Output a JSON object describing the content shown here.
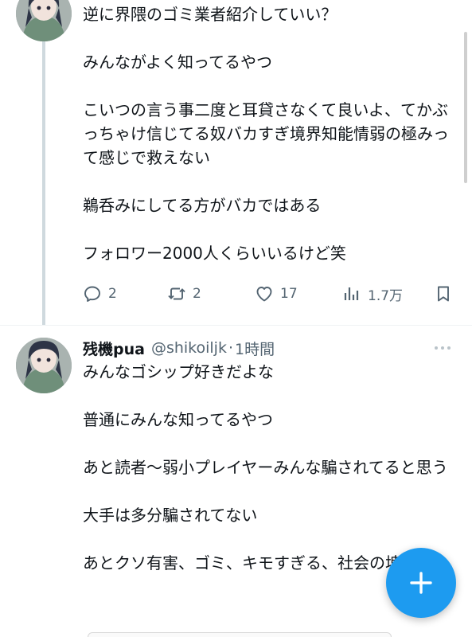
{
  "tweet1": {
    "paragraphs": [
      "逆に界隈のゴミ業者紹介していい？",
      "みんながよく知ってるやつ",
      "こいつの言う事二度と耳貸さなくて良いよ、てかぶっちゃけ信じてる奴バカすぎ境界知能情弱の極みって感じで救えない",
      "鵜呑みにしてる方がバカではある",
      "フォロワー2000人くらいいるけど笑"
    ],
    "actions": {
      "reply_count": "2",
      "retweet_count": "2",
      "like_count": "17",
      "view_count": "1.7万"
    }
  },
  "tweet2": {
    "name": "残機pua",
    "handle": "@shikoiljk",
    "separator": "·",
    "time": "1時間",
    "paragraphs": [
      "みんなゴシップ好きだよな",
      "普通にみんな知ってるやつ",
      "あと読者〜弱小プレイヤーみんな騙されてると思う",
      "大手は多分騙されてない",
      "あとクソ有害、ゴミ、キモすぎる、社会の塊"
    ]
  },
  "icons": {
    "reply": "reply-icon",
    "retweet": "retweet-icon",
    "like": "heart-icon",
    "views": "views-icon",
    "bookmark": "bookmark-icon",
    "more": "more-icon",
    "compose": "plus-icon"
  },
  "colors": {
    "accent": "#1d9bf0",
    "secondary_text": "#536471",
    "thread_line": "#cfd9de"
  }
}
